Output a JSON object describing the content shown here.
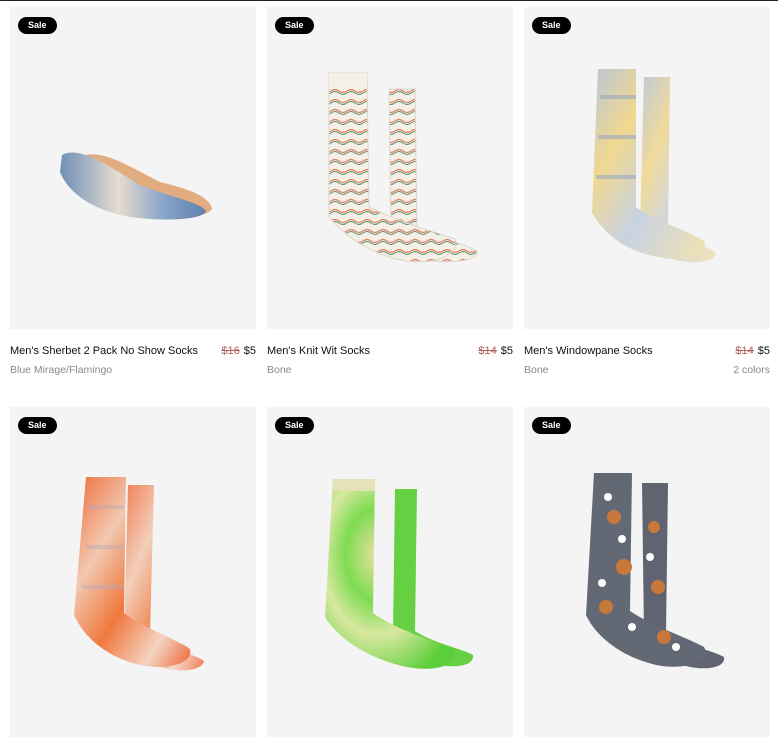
{
  "badge_label": "Sale",
  "products": [
    {
      "name": "Men's Sherbet 2 Pack No Show Socks",
      "old_price": "$16",
      "price": "$5",
      "variant": "Blue Mirage/Flamingo",
      "colors": ""
    },
    {
      "name": "Men's Knit Wit Socks",
      "old_price": "$14",
      "price": "$5",
      "variant": "Bone",
      "colors": ""
    },
    {
      "name": "Men's Windowpane Socks",
      "old_price": "$14",
      "price": "$5",
      "variant": "Bone",
      "colors": "2 colors"
    },
    {
      "name": "",
      "old_price": "",
      "price": "",
      "variant": "",
      "colors": ""
    },
    {
      "name": "",
      "old_price": "",
      "price": "",
      "variant": "",
      "colors": ""
    },
    {
      "name": "",
      "old_price": "",
      "price": "",
      "variant": "",
      "colors": ""
    }
  ],
  "colors": {
    "badge_bg": "#000000",
    "strike_price": "#b0605a",
    "card_bg": "#f4f4f4"
  }
}
